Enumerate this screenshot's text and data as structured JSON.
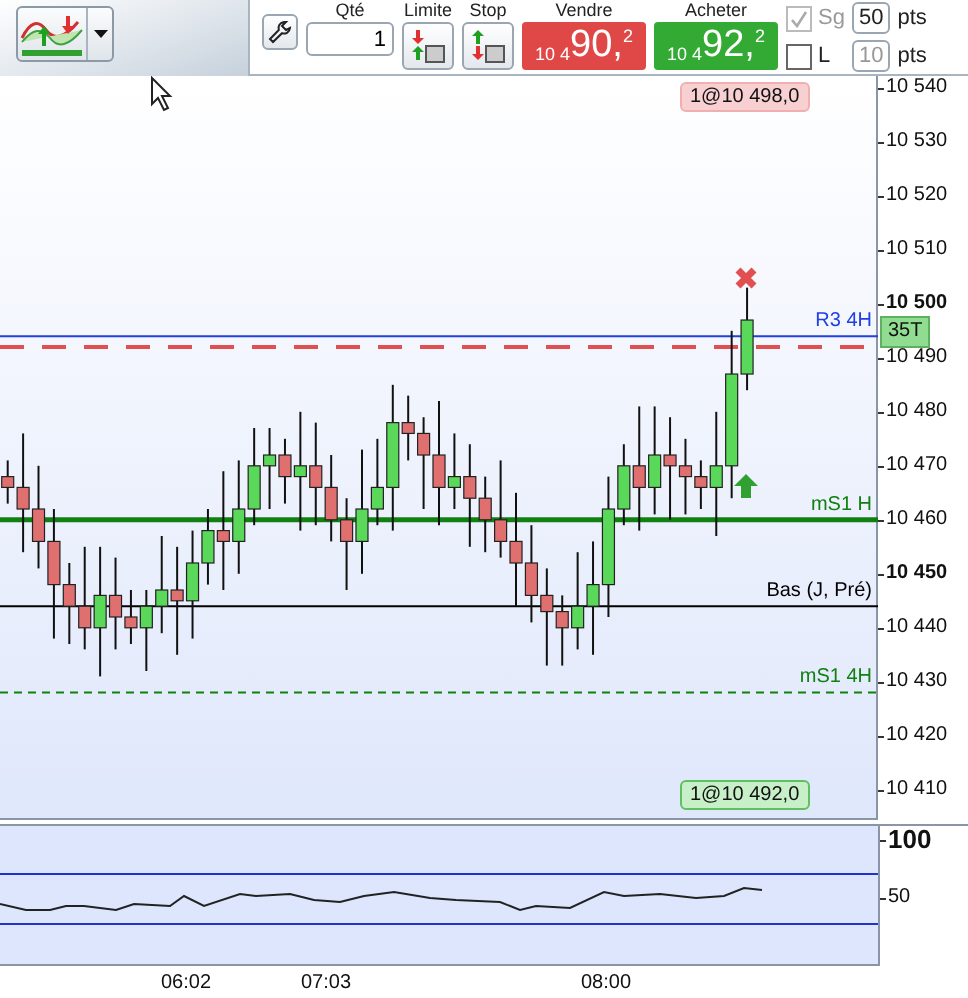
{
  "toolbar": {
    "strategy_menu": {
      "expanded": false
    }
  },
  "order_panel": {
    "quantity": {
      "label": "Qté",
      "value": "1"
    },
    "limit": {
      "label": "Limite"
    },
    "stop": {
      "label": "Stop"
    },
    "sell": {
      "label": "Vendre",
      "price_prefix": "10 4",
      "price_main": "90,",
      "price_decimal": "2"
    },
    "buy": {
      "label": "Acheter",
      "price_prefix": "10 4",
      "price_main": "92,",
      "price_decimal": "2"
    },
    "options": [
      {
        "label": "Sg",
        "checked": true,
        "disabled": true,
        "points": "50",
        "points_disabled": false,
        "unit": "pts"
      },
      {
        "label": "L",
        "checked": false,
        "disabled": false,
        "points": "10",
        "points_disabled": true,
        "unit": "pts"
      }
    ]
  },
  "chart": {
    "orders": [
      {
        "label": "1@10 498,0",
        "kind": "sell"
      },
      {
        "label": "1@10 492,0",
        "kind": "buy"
      }
    ],
    "chart_data": {
      "type": "candlestick",
      "ylim": [
        10404.4,
        10542.2
      ],
      "yticks": [
        {
          "value": 10540,
          "label": "10 540"
        },
        {
          "value": 10530,
          "label": "10 530"
        },
        {
          "value": 10520,
          "label": "10 520"
        },
        {
          "value": 10510,
          "label": "10 510"
        },
        {
          "value": 10500,
          "label": "10 500"
        },
        {
          "value": 10490,
          "label": "10 490"
        },
        {
          "value": 10480,
          "label": "10 480"
        },
        {
          "value": 10470,
          "label": "10 470"
        },
        {
          "value": 10460,
          "label": "10 460"
        },
        {
          "value": 10450,
          "label": "10 450"
        },
        {
          "value": 10440,
          "label": "10 440"
        },
        {
          "value": 10430,
          "label": "10 430"
        },
        {
          "value": 10420,
          "label": "10 420"
        },
        {
          "value": 10410,
          "label": "10 410"
        }
      ],
      "categories": [
        null,
        null,
        null,
        null,
        null,
        null,
        null,
        null,
        null,
        null,
        null,
        null,
        null,
        null,
        null,
        null,
        null,
        null,
        null,
        null,
        null,
        null,
        null,
        null,
        null,
        null,
        null,
        null,
        null,
        null,
        null,
        null,
        null,
        null,
        null,
        null,
        null,
        null,
        null,
        null,
        null,
        null,
        null,
        null,
        null,
        null,
        null,
        null,
        null,
        null,
        null,
        null,
        null,
        null,
        null,
        null,
        null
      ],
      "ref_lines": [
        {
          "axis": "y",
          "value": 10494,
          "label": "R3 4H",
          "color": "#2040e0"
        },
        {
          "axis": "y",
          "value": 10492,
          "color": "#e05050"
        },
        {
          "axis": "y",
          "value": 10460,
          "label": "mS1 H",
          "color": "#108010"
        },
        {
          "axis": "y",
          "value": 10444,
          "label": "Bas (J, Pré)",
          "color": "#000000"
        },
        {
          "axis": "y",
          "value": 10428,
          "label": "mS1 4H",
          "color": "#108010"
        }
      ],
      "ohlc": [
        [
          10468,
          10471,
          10463,
          10466
        ],
        [
          10466,
          10476,
          10454,
          10462
        ],
        [
          10462,
          10470,
          10451,
          10456
        ],
        [
          10456,
          10462,
          10438,
          10448
        ],
        [
          10448,
          10452,
          10437,
          10444
        ],
        [
          10444,
          10455,
          10436,
          10440
        ],
        [
          10440,
          10455,
          10431,
          10446
        ],
        [
          10446,
          10453,
          10436,
          10442
        ],
        [
          10442,
          10447,
          10437,
          10440
        ],
        [
          10440,
          10447,
          10432,
          10444
        ],
        [
          10444,
          10457,
          10439,
          10447
        ],
        [
          10447,
          10455,
          10435,
          10445
        ],
        [
          10445,
          10458,
          10438,
          10452
        ],
        [
          10452,
          10462,
          10448,
          10458
        ],
        [
          10458,
          10469,
          10447,
          10456
        ],
        [
          10456,
          10471,
          10450,
          10462
        ],
        [
          10462,
          10477,
          10459,
          10470
        ],
        [
          10470,
          10477,
          10462,
          10472
        ],
        [
          10472,
          10475,
          10463,
          10468
        ],
        [
          10468,
          10480,
          10458,
          10470
        ],
        [
          10470,
          10478,
          10459,
          10466
        ],
        [
          10466,
          10472,
          10456,
          10460
        ],
        [
          10460,
          10464,
          10447,
          10456
        ],
        [
          10456,
          10473,
          10450,
          10462
        ],
        [
          10462,
          10475,
          10459,
          10466
        ],
        [
          10466,
          10485,
          10458,
          10478
        ],
        [
          10478,
          10483,
          10471,
          10476
        ],
        [
          10476,
          10479,
          10462,
          10472
        ],
        [
          10472,
          10482,
          10459,
          10466
        ],
        [
          10466,
          10476,
          10462,
          10468
        ],
        [
          10468,
          10474,
          10455,
          10464
        ],
        [
          10464,
          10468,
          10454,
          10460
        ],
        [
          10460,
          10471,
          10453,
          10456
        ],
        [
          10456,
          10465,
          10444,
          10452
        ],
        [
          10452,
          10459,
          10441,
          10446
        ],
        [
          10446,
          10451,
          10433,
          10443
        ],
        [
          10443,
          10446,
          10433,
          10440
        ],
        [
          10440,
          10454,
          10436,
          10444
        ],
        [
          10444,
          10456,
          10435,
          10448
        ],
        [
          10448,
          10468,
          10442,
          10462
        ],
        [
          10462,
          10474,
          10459,
          10470
        ],
        [
          10470,
          10481,
          10458,
          10466
        ],
        [
          10466,
          10481,
          10461,
          10472
        ],
        [
          10472,
          10479,
          10460,
          10470
        ],
        [
          10470,
          10475,
          10461,
          10468
        ],
        [
          10468,
          10471,
          10462,
          10466
        ],
        [
          10466,
          10480,
          10457,
          10470
        ],
        [
          10470,
          10495,
          10464,
          10487
        ],
        [
          10487,
          10503,
          10484,
          10497
        ],
        null,
        null,
        null,
        null,
        null,
        null,
        null,
        null
      ]
    },
    "timer": "35T"
  },
  "indicator": {
    "axis": [
      {
        "label": "100",
        "bold": true
      },
      {
        "label": "50",
        "bold": false
      }
    ]
  },
  "time_axis": [
    "06:02",
    "07:03",
    "08:00"
  ]
}
